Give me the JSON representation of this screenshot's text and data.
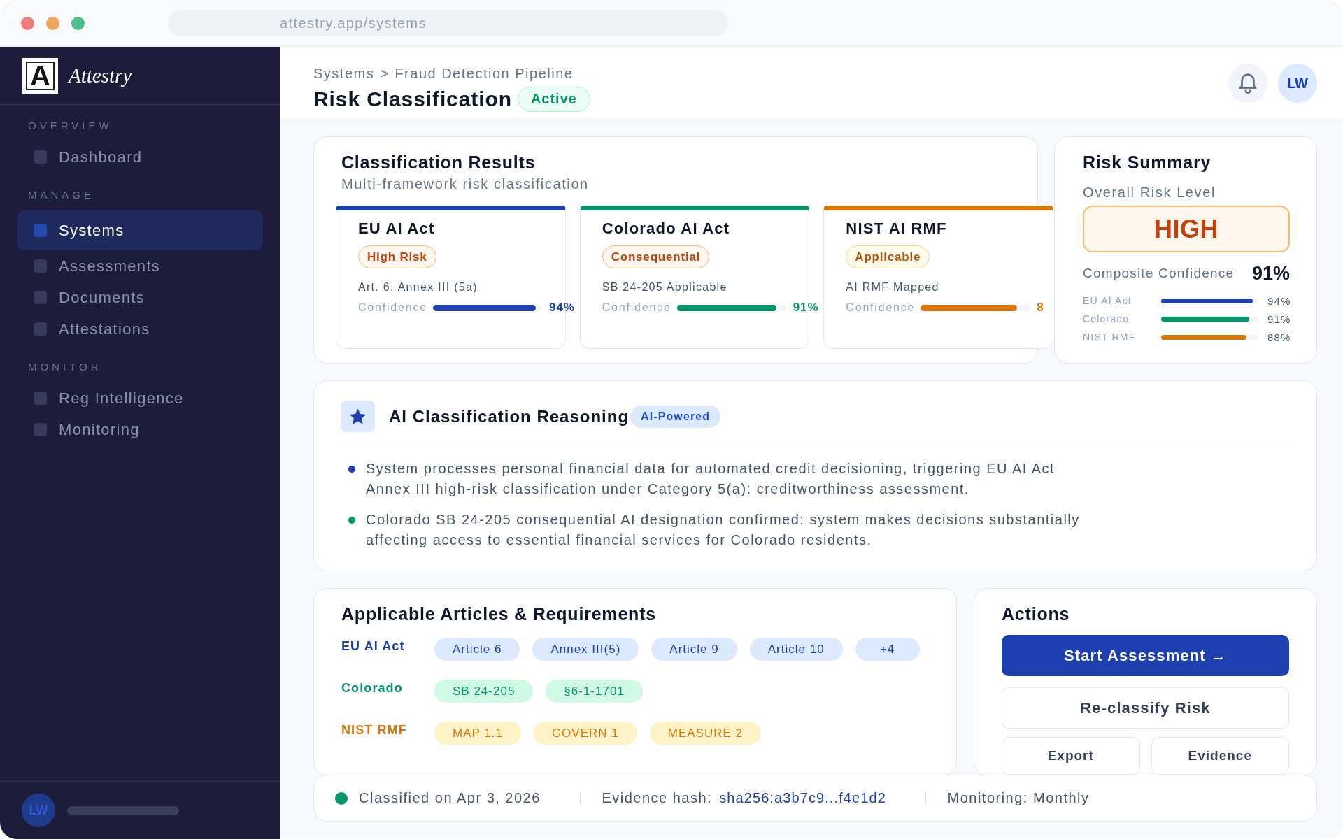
{
  "window": {
    "url": "attestry.app/systems"
  },
  "sidebar": {
    "logo_mark": "A",
    "brand": "Attestry",
    "sections": [
      {
        "label": "OVERVIEW",
        "items": [
          {
            "label": "Dashboard",
            "selected": false
          }
        ]
      },
      {
        "label": "MANAGE",
        "items": [
          {
            "label": "Systems",
            "selected": true
          },
          {
            "label": "Assessments",
            "selected": false
          },
          {
            "label": "Documents",
            "selected": false
          },
          {
            "label": "Attestations",
            "selected": false
          }
        ]
      },
      {
        "label": "MONITOR",
        "items": [
          {
            "label": "Reg Intelligence",
            "selected": false
          },
          {
            "label": "Monitoring",
            "selected": false
          }
        ]
      }
    ],
    "user": {
      "initials": "LW"
    }
  },
  "header": {
    "breadcrumb": {
      "items": [
        "Systems",
        "Fraud Detection Pipeline"
      ],
      "separator": ">"
    },
    "title": "Risk Classification",
    "status": "Active",
    "avatar_initials": "LW"
  },
  "classification_results": {
    "title": "Classification Results",
    "subtitle": "Multi-framework risk classification",
    "frameworks": [
      {
        "name": "EU AI Act",
        "color": "#1e40af",
        "badge": {
          "label": "High Risk",
          "kind": "high"
        },
        "detail": "Art. 6, Annex III (5a)",
        "confidence_label": "Confidence",
        "level": 0.94,
        "reading": "94%"
      },
      {
        "name": "Colorado AI Act",
        "color": "#059669",
        "badge": {
          "label": "Consequential",
          "kind": "high"
        },
        "detail": "SB 24-205 Applicable",
        "confidence_label": "Confidence",
        "level": 0.91,
        "reading": "91%"
      },
      {
        "name": "NIST AI RMF",
        "color": "#d97706",
        "badge": {
          "label": "Applicable",
          "kind": "medium"
        },
        "detail": "AI RMF Mapped",
        "confidence_label": "Confidence",
        "level": 0.88,
        "reading": "8"
      }
    ]
  },
  "risk_summary": {
    "title": "Risk Summary",
    "overall_label": "Overall Risk Level",
    "overall_value": "HIGH",
    "composite_label": "Composite Confidence",
    "composite_value": "91%",
    "breakdown": [
      {
        "name": "EU AI Act",
        "color": "#1e40af",
        "level": 0.94,
        "reading": "94%"
      },
      {
        "name": "Colorado",
        "color": "#059669",
        "level": 0.91,
        "reading": "91%"
      },
      {
        "name": "NIST RMF",
        "color": "#d97706",
        "level": 0.88,
        "reading": "88%"
      }
    ]
  },
  "reasoning": {
    "title": "AI Classification Reasoning",
    "badge": "AI-Powered",
    "points": [
      {
        "text": "System processes personal financial data for automated credit decisioning, triggering EU AI Act Annex III high-risk classification under Category 5(a): creditworthiness assessment.",
        "color": "#1e40af"
      },
      {
        "text": "Colorado SB 24-205 consequential AI designation confirmed: system makes decisions substantially affecting access to essential financial services for Colorado residents.",
        "color": "#059669"
      }
    ]
  },
  "articles": {
    "title": "Applicable Articles & Requirements",
    "groups": [
      {
        "framework": {
          "label": "EU AI Act",
          "color": "#1e40af"
        },
        "tags": {
          "color": "#dbeafe",
          "items": [
            "Article 6",
            "Annex III(5)",
            "Article 9",
            "Article 10",
            "+4"
          ]
        }
      },
      {
        "framework": {
          "label": "Colorado",
          "color": "#059669"
        },
        "tags": {
          "color": "#d1fae5",
          "items": [
            "SB 24-205",
            "§6-1-1701"
          ]
        }
      },
      {
        "framework": {
          "label": "NIST RMF",
          "color": "#d97706"
        },
        "tags": {
          "color": "#fef3c7",
          "items": [
            "MAP 1.1",
            "GOVERN 1",
            "MEASURE 2"
          ]
        }
      }
    ]
  },
  "actions": {
    "title": "Actions",
    "buttons": [
      {
        "label": "Start Assessment →",
        "kind": "primary"
      },
      {
        "label": "Re-classify Risk",
        "kind": "secondary"
      },
      {
        "label": "Export",
        "kind": "small"
      },
      {
        "label": "Evidence",
        "kind": "small"
      }
    ]
  },
  "footer": {
    "status": {
      "color": "#059669",
      "text": "Classified on Apr 3, 2026"
    },
    "hash_label": "Evidence hash:",
    "hash": "sha256:a3b7c9...f4e1d2",
    "monitoring": "Monitoring: Monthly"
  }
}
